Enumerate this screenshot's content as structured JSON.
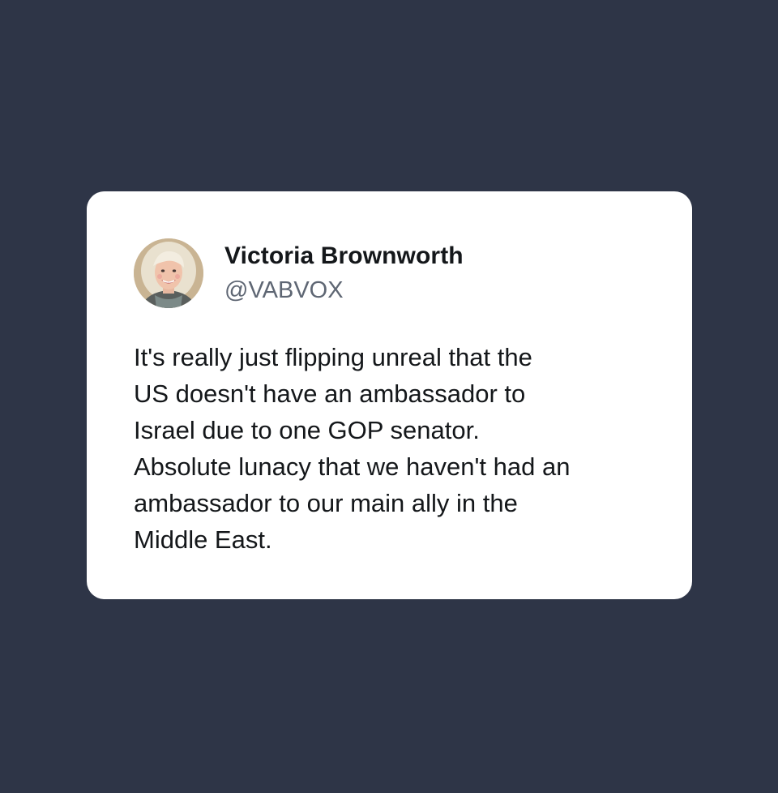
{
  "tweet": {
    "author_name": "Victoria Brownworth",
    "author_handle": "@VABVOX",
    "avatar_icon": "profile-photo",
    "text": "It's really just flipping unreal that the\nUS doesn't have an ambassador to\nIsrael due to one GOP senator.\nAbsolute lunacy that we haven't had an\nambassador to our main ally in the\nMiddle East."
  },
  "colors": {
    "background": "#2e3547",
    "card": "#ffffff",
    "name": "#14171a",
    "handle": "#5e6673",
    "text": "#14171a"
  }
}
